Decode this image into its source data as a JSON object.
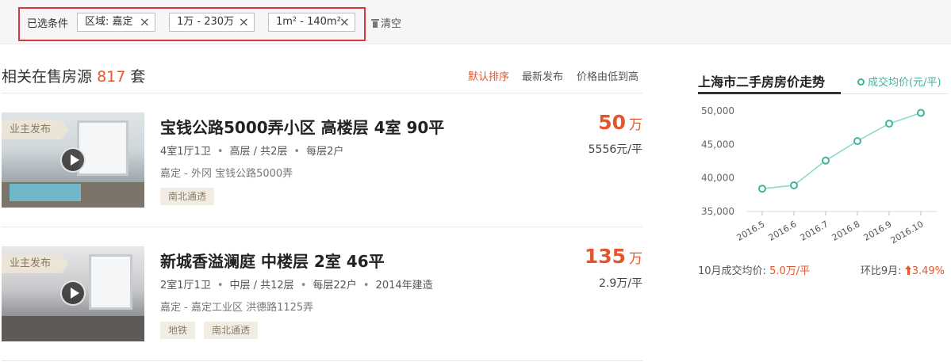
{
  "filters": {
    "title": "已选条件",
    "chips": [
      {
        "label": "区域: 嘉定"
      },
      {
        "label": "1万 - 230万"
      },
      {
        "label": "1m² - 140m²"
      }
    ],
    "remove_icon": "×",
    "clear_label": "清空"
  },
  "listing_header": {
    "count_prefix": "相关在售房源",
    "count": "817",
    "count_suffix": "套",
    "sort_options": [
      "默认排序",
      "最新发布",
      "价格由低到高"
    ],
    "active_sort": "默认排序"
  },
  "listings": [
    {
      "badge": "业主发布",
      "title": "宝钱公路5000弄小区 高楼层 4室 90平",
      "meta": [
        "4室1厅1卫",
        "高层 / 共2层",
        "每层2户"
      ],
      "location": "嘉定 - 外冈 宝钱公路5000弄",
      "tags": [
        "南北通透"
      ],
      "price": "50",
      "price_unit": "万",
      "unit_price": "5556元/平"
    },
    {
      "badge": "业主发布",
      "title": "新城香溢澜庭 中楼层 2室 46平",
      "meta": [
        "2室1厅1卫",
        "中层 / 共12层",
        "每层22户",
        "2014年建造"
      ],
      "location": "嘉定 - 嘉定工业区 洪德路1125弄",
      "tags": [
        "地铁",
        "南北通透"
      ],
      "price": "135",
      "price_unit": "万",
      "unit_price": "2.9万/平"
    }
  ],
  "trend": {
    "title": "上海市二手房房价走势",
    "legend": "成交均价(元/平)",
    "footer_left_label": "10月成交均价:",
    "footer_left_value": "5.0万/平",
    "footer_right_label": "环比9月:",
    "footer_right_value": "3.49%"
  },
  "colors": {
    "accent": "#e4572e",
    "line": "#8fd9cc",
    "marker": "#3fb39e",
    "filter_outline": "#d9363e"
  },
  "chart_data": {
    "type": "line",
    "categories": [
      "2016.5",
      "2016.6",
      "2016.7",
      "2016.8",
      "2016.9",
      "2016.10"
    ],
    "series": [
      {
        "name": "成交均价(元/平)",
        "values": [
          38400,
          38900,
          42600,
          45500,
          48100,
          49700
        ]
      }
    ],
    "y_ticks": [
      "50,000",
      "45,000",
      "40,000",
      "35,000"
    ],
    "ylim": [
      35000,
      50000
    ],
    "grid": false,
    "legend": "top-right"
  }
}
